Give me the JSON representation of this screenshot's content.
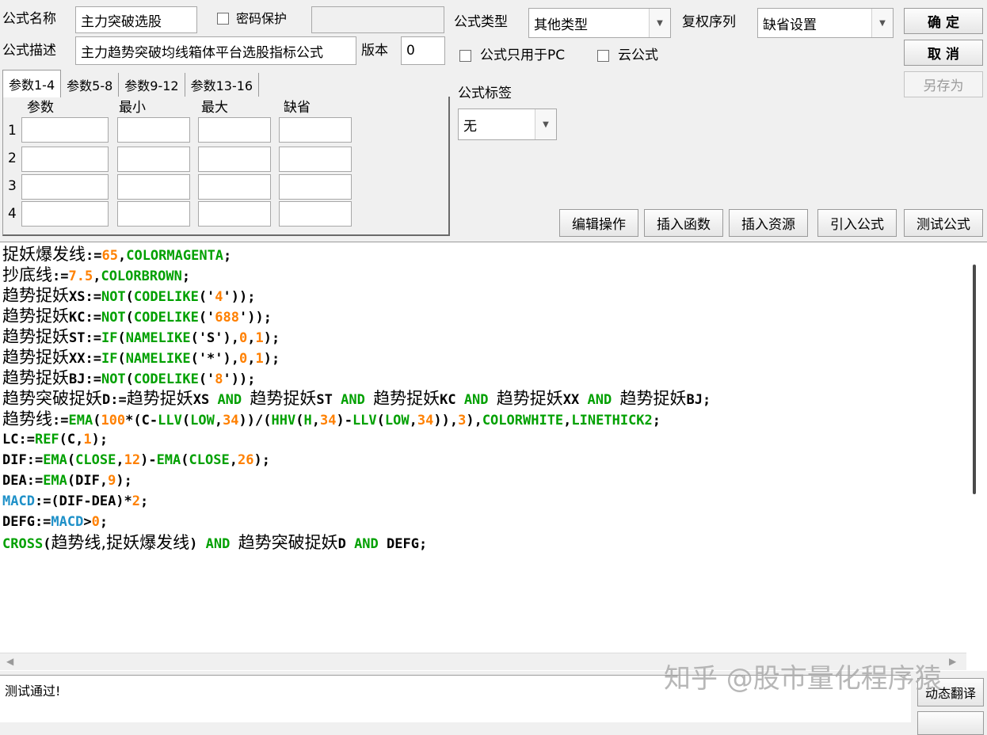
{
  "form": {
    "name_label": "公式名称",
    "name_value": "主力突破选股",
    "password_label": "密码保护",
    "desc_label": "公式描述",
    "desc_value": "主力趋势突破均线箱体平台选股指标公式",
    "version_label": "版本",
    "version_value": "0",
    "type_label": "公式类型",
    "type_value": "其他类型",
    "rights_label": "复权序列",
    "rights_value": "缺省设置",
    "pc_only_label": "公式只用于PC",
    "cloud_label": "云公式",
    "tag_label": "公式标签",
    "tag_value": "无"
  },
  "buttons": {
    "ok": "确  定",
    "cancel": "取  消",
    "save_as": "另存为",
    "edit_ops": "编辑操作",
    "insert_func": "插入函数",
    "insert_res": "插入资源",
    "import_formula": "引入公式",
    "test_formula": "测试公式",
    "auto_translate": "动态翻译"
  },
  "params": {
    "tabs": [
      "参数1-4",
      "参数5-8",
      "参数9-12",
      "参数13-16"
    ],
    "headers": [
      "参数",
      "最小",
      "最大",
      "缺省"
    ],
    "rows": [
      "1",
      "2",
      "3",
      "4"
    ]
  },
  "code": [
    [
      [
        "cn",
        "捉妖爆发线"
      ],
      [
        "b",
        ":="
      ],
      [
        "num",
        "65"
      ],
      [
        "b",
        ","
      ],
      [
        "g",
        "COLORMAGENTA"
      ],
      [
        "b",
        ";"
      ]
    ],
    [
      [
        "cn",
        "抄底线"
      ],
      [
        "b",
        ":="
      ],
      [
        "num",
        "7.5"
      ],
      [
        "b",
        ","
      ],
      [
        "g",
        "COLORBROWN"
      ],
      [
        "b",
        ";"
      ]
    ],
    [
      [
        "cn",
        "趋势捉妖"
      ],
      [
        "b",
        "XS:="
      ],
      [
        "g",
        "NOT"
      ],
      [
        "b",
        "("
      ],
      [
        "g",
        "CODELIKE"
      ],
      [
        "b",
        "('"
      ],
      [
        "num",
        "4"
      ],
      [
        "b",
        "'));"
      ]
    ],
    [
      [
        "cn",
        "趋势捉妖"
      ],
      [
        "b",
        "KC:="
      ],
      [
        "g",
        "NOT"
      ],
      [
        "b",
        "("
      ],
      [
        "g",
        "CODELIKE"
      ],
      [
        "b",
        "('"
      ],
      [
        "num",
        "688"
      ],
      [
        "b",
        "'));"
      ]
    ],
    [
      [
        "cn",
        "趋势捉妖"
      ],
      [
        "b",
        "ST:="
      ],
      [
        "g",
        "IF"
      ],
      [
        "b",
        "("
      ],
      [
        "g",
        "NAMELIKE"
      ],
      [
        "b",
        "('S'),"
      ],
      [
        "num",
        "0"
      ],
      [
        "b",
        ","
      ],
      [
        "num",
        "1"
      ],
      [
        "b",
        ");"
      ]
    ],
    [
      [
        "cn",
        "趋势捉妖"
      ],
      [
        "b",
        "XX:="
      ],
      [
        "g",
        "IF"
      ],
      [
        "b",
        "("
      ],
      [
        "g",
        "NAMELIKE"
      ],
      [
        "b",
        "('*'),"
      ],
      [
        "num",
        "0"
      ],
      [
        "b",
        ","
      ],
      [
        "num",
        "1"
      ],
      [
        "b",
        ");"
      ]
    ],
    [
      [
        "cn",
        "趋势捉妖"
      ],
      [
        "b",
        "BJ:="
      ],
      [
        "g",
        "NOT"
      ],
      [
        "b",
        "("
      ],
      [
        "g",
        "CODELIKE"
      ],
      [
        "b",
        "('"
      ],
      [
        "num",
        "8"
      ],
      [
        "b",
        "'));"
      ]
    ],
    [
      [
        "cn",
        "趋势突破捉妖"
      ],
      [
        "b",
        "D:="
      ],
      [
        "cn",
        "趋势捉妖"
      ],
      [
        "b",
        "XS "
      ],
      [
        "g",
        "AND"
      ],
      [
        "b",
        " "
      ],
      [
        "cn",
        "趋势捉妖"
      ],
      [
        "b",
        "ST "
      ],
      [
        "g",
        "AND"
      ],
      [
        "b",
        " "
      ],
      [
        "cn",
        "趋势捉妖"
      ],
      [
        "b",
        "KC "
      ],
      [
        "g",
        "AND"
      ],
      [
        "b",
        " "
      ],
      [
        "cn",
        "趋势捉妖"
      ],
      [
        "b",
        "XX "
      ],
      [
        "g",
        "AND"
      ],
      [
        "b",
        " "
      ],
      [
        "cn",
        "趋势捉妖"
      ],
      [
        "b",
        "BJ;"
      ]
    ],
    [
      [
        "cn",
        "趋势线"
      ],
      [
        "b",
        ":="
      ],
      [
        "g",
        "EMA"
      ],
      [
        "b",
        "("
      ],
      [
        "num",
        "100"
      ],
      [
        "b",
        "*(C-"
      ],
      [
        "g",
        "LLV"
      ],
      [
        "b",
        "("
      ],
      [
        "g",
        "LOW"
      ],
      [
        "b",
        ","
      ],
      [
        "num",
        "34"
      ],
      [
        "b",
        "))/("
      ],
      [
        "g",
        "HHV"
      ],
      [
        "b",
        "("
      ],
      [
        "g",
        "H"
      ],
      [
        "b",
        ","
      ],
      [
        "num",
        "34"
      ],
      [
        "b",
        ")-"
      ],
      [
        "g",
        "LLV"
      ],
      [
        "b",
        "("
      ],
      [
        "g",
        "LOW"
      ],
      [
        "b",
        ","
      ],
      [
        "num",
        "34"
      ],
      [
        "b",
        ")),"
      ],
      [
        "num",
        "3"
      ],
      [
        "b",
        "),"
      ],
      [
        "g",
        "COLORWHITE"
      ],
      [
        "b",
        ","
      ],
      [
        "g",
        "LINETHICK2"
      ],
      [
        "b",
        ";"
      ]
    ],
    [
      [
        "b",
        "LC:="
      ],
      [
        "g",
        "REF"
      ],
      [
        "b",
        "(C,"
      ],
      [
        "num",
        "1"
      ],
      [
        "b",
        ");"
      ]
    ],
    [
      [
        "b",
        "DIF:="
      ],
      [
        "g",
        "EMA"
      ],
      [
        "b",
        "("
      ],
      [
        "g",
        "CLOSE"
      ],
      [
        "b",
        ","
      ],
      [
        "num",
        "12"
      ],
      [
        "b",
        ")-"
      ],
      [
        "g",
        "EMA"
      ],
      [
        "b",
        "("
      ],
      [
        "g",
        "CLOSE"
      ],
      [
        "b",
        ","
      ],
      [
        "num",
        "26"
      ],
      [
        "b",
        ");"
      ]
    ],
    [
      [
        "b",
        "DEA:="
      ],
      [
        "g",
        "EMA"
      ],
      [
        "b",
        "(DIF,"
      ],
      [
        "num",
        "9"
      ],
      [
        "b",
        ");"
      ]
    ],
    [
      [
        "blue",
        "MACD"
      ],
      [
        "b",
        ":=(DIF-DEA)*"
      ],
      [
        "num",
        "2"
      ],
      [
        "b",
        ";"
      ]
    ],
    [
      [
        "b",
        "DEFG:="
      ],
      [
        "blue",
        "MACD"
      ],
      [
        "b",
        ">"
      ],
      [
        "num",
        "0"
      ],
      [
        "b",
        ";"
      ]
    ],
    [
      [
        "g",
        "CROSS"
      ],
      [
        "b",
        "("
      ],
      [
        "cn",
        "趋势线,捉妖爆发线"
      ],
      [
        "b",
        ") "
      ],
      [
        "g",
        "AND"
      ],
      [
        "b",
        " "
      ],
      [
        "cn",
        "趋势突破捉妖"
      ],
      [
        "b",
        "D "
      ],
      [
        "g",
        "AND"
      ],
      [
        "b",
        " DEFG;"
      ]
    ]
  ],
  "status": {
    "message": "测试通过!"
  },
  "watermark": "知乎 @股市量化程序猿"
}
